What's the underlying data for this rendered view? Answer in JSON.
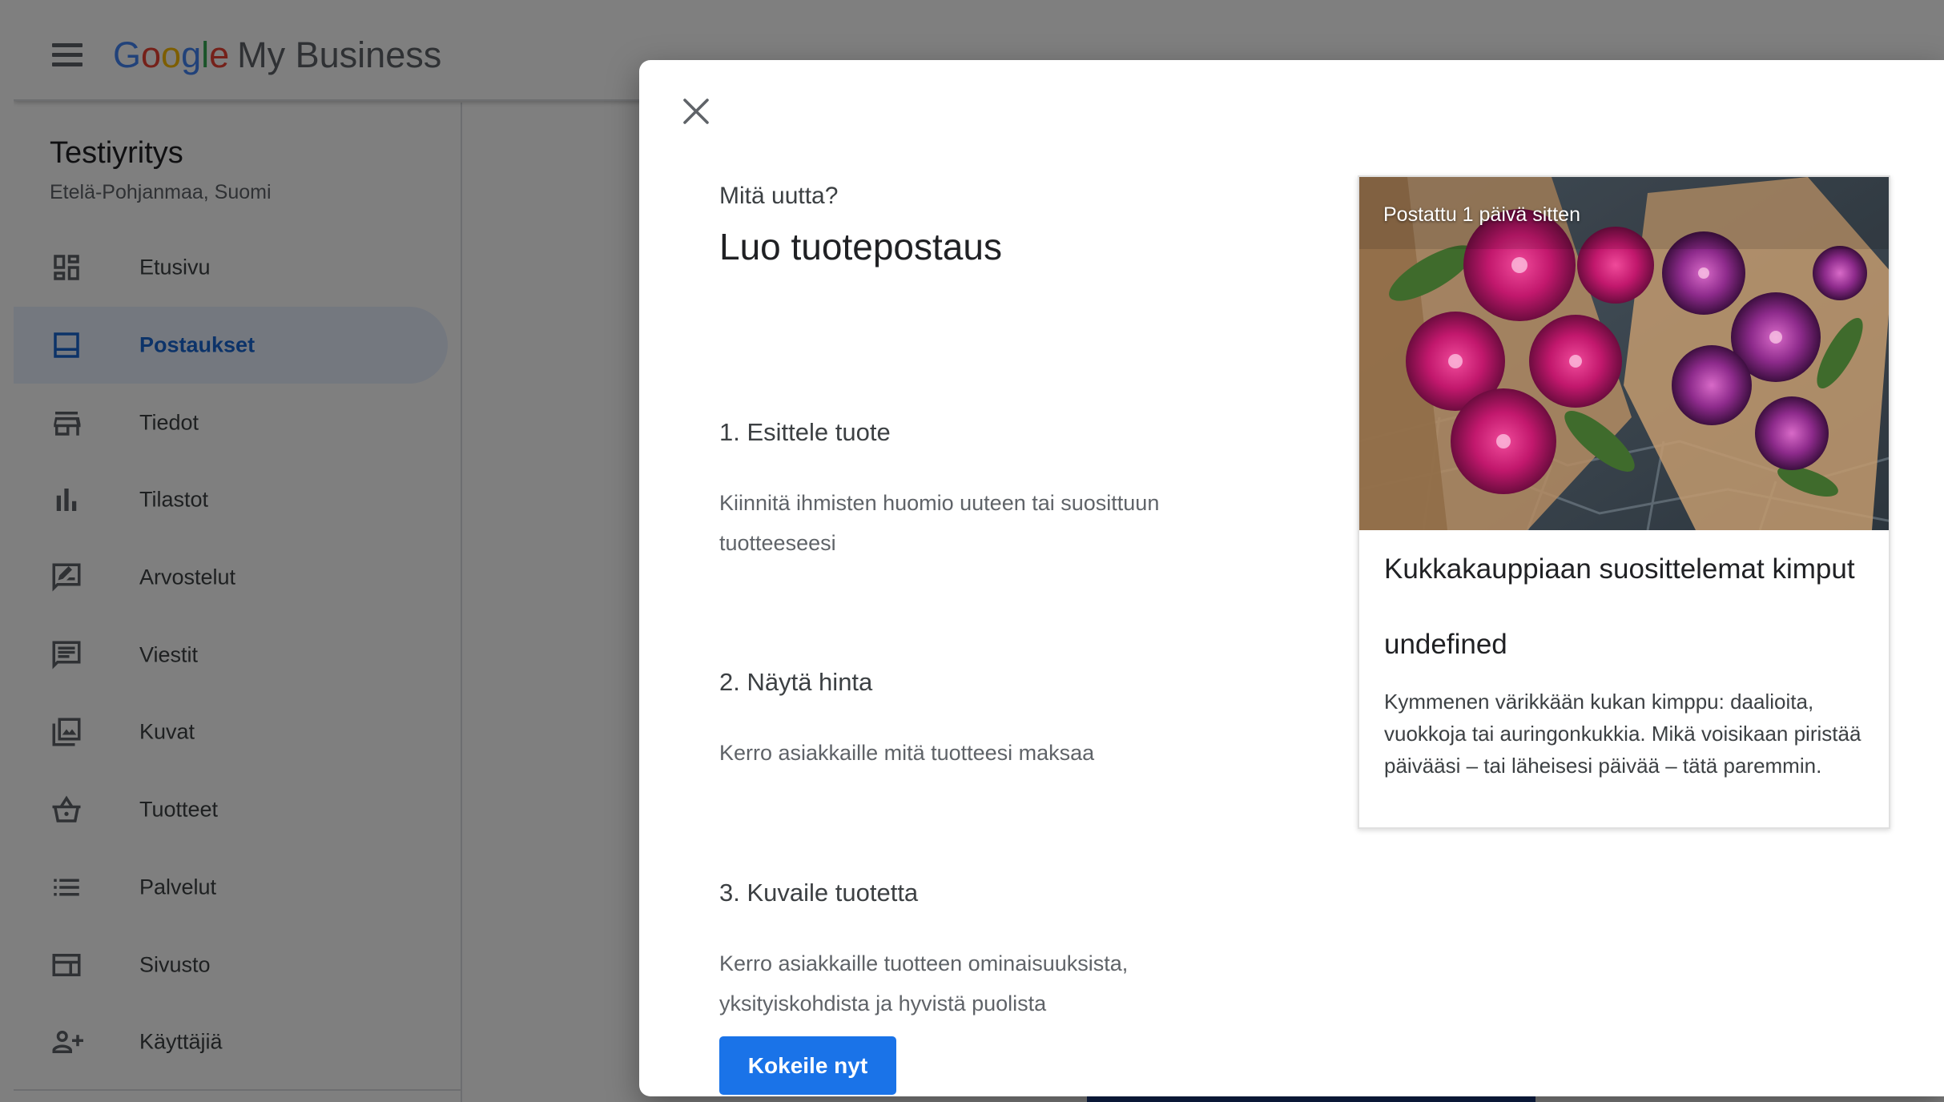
{
  "app": {
    "brand_letters": [
      "G",
      "o",
      "o",
      "g",
      "l",
      "e"
    ],
    "brand_rest": "My Business"
  },
  "sidebar": {
    "business_name": "Testiyritys",
    "business_location": "Etelä-Pohjanmaa, Suomi",
    "items": [
      {
        "label": "Etusivu",
        "icon": "dashboard-icon",
        "active": false
      },
      {
        "label": "Postaukset",
        "icon": "posts-icon",
        "active": true
      },
      {
        "label": "Tiedot",
        "icon": "store-icon",
        "active": false
      },
      {
        "label": "Tilastot",
        "icon": "bar-chart-icon",
        "active": false
      },
      {
        "label": "Arvostelut",
        "icon": "rate-review-icon",
        "active": false
      },
      {
        "label": "Viestit",
        "icon": "chat-icon",
        "active": false
      },
      {
        "label": "Kuvat",
        "icon": "photo-library-icon",
        "active": false
      },
      {
        "label": "Tuotteet",
        "icon": "shopping-basket-icon",
        "active": false
      },
      {
        "label": "Palvelut",
        "icon": "list-icon",
        "active": false
      },
      {
        "label": "Sivusto",
        "icon": "web-icon",
        "active": false
      },
      {
        "label": "Käyttäjiä",
        "icon": "person-add-icon",
        "active": false
      }
    ]
  },
  "dialog": {
    "kicker": "Mitä uutta?",
    "title": "Luo tuotepostaus",
    "steps": [
      {
        "title": "1. Esittele tuote",
        "description": "Kiinnitä ihmisten huomio uuteen tai suosittuun tuotteeseesi"
      },
      {
        "title": "2. Näytä hinta",
        "description": "Kerro asiakkaille mitä tuotteesi maksaa"
      },
      {
        "title": "3. Kuvaile tuotetta",
        "description": "Kerro asiakkaille tuotteen ominaisuuksista, yksityiskohdista ja hyvistä puolista"
      }
    ],
    "cta_label": "Kokeile nyt",
    "preview": {
      "posted_label": "Postattu 1 päivä sitten",
      "product_title": "Kukkakauppiaan suosittelemat kimput",
      "product_price": "undefined",
      "product_description": "Kymmenen värikkään kukan kimppu: daalioita, vuokkoja tai auringonkukkia. Mikä voisikaan piristää päivääsi – tai läheisesi päivää – tätä paremmin."
    }
  },
  "colors": {
    "accent": "#1a73e8",
    "active_nav_bg": "#e8f0fe",
    "active_nav_text": "#1967d2",
    "google_blue": "#4285F4",
    "google_red": "#EA4335",
    "google_yellow": "#FBBC05",
    "google_green": "#34A853"
  }
}
